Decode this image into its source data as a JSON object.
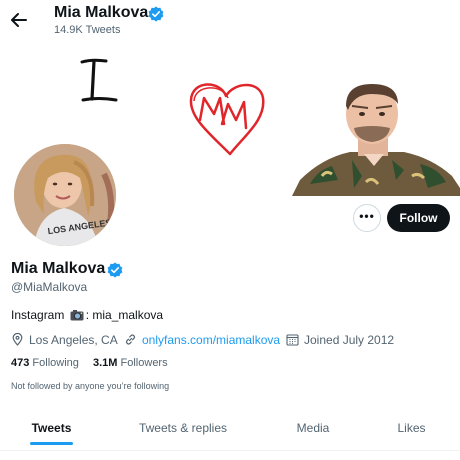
{
  "header": {
    "back_icon": "arrow-left-icon",
    "name": "Mia Malkova",
    "tweet_count": "14.9K Tweets",
    "verified_icon": "verified-badge-icon"
  },
  "banner": {
    "handwritten_letter": "I",
    "heart_letters": "M",
    "heart_color": "#e0262b"
  },
  "profile": {
    "display_name": "Mia Malkova",
    "handle": "@MiaMalkova",
    "bio_prefix": "Instagram",
    "bio_suffix": ": mia_malkova",
    "bio_icon": "camera-emoji-icon",
    "location": "Los Angeles, CA",
    "website": "onlyfans.com/miamalkova",
    "joined": "Joined July 2012",
    "following_count": "473",
    "following_label": "Following",
    "followers_count": "3.1M",
    "followers_label": "Followers",
    "mutuals_note": "Not followed by anyone you’re following"
  },
  "actions": {
    "more_label": "•••",
    "follow_label": "Follow"
  },
  "tabs": [
    {
      "label": "Tweets",
      "active": true
    },
    {
      "label": "Tweets & replies",
      "active": false
    },
    {
      "label": "Media",
      "active": false
    },
    {
      "label": "Likes",
      "active": false
    }
  ],
  "colors": {
    "accent": "#1d9bf0",
    "text_primary": "#0f1419",
    "text_secondary": "#536471",
    "follow_button": "#0f1419"
  }
}
